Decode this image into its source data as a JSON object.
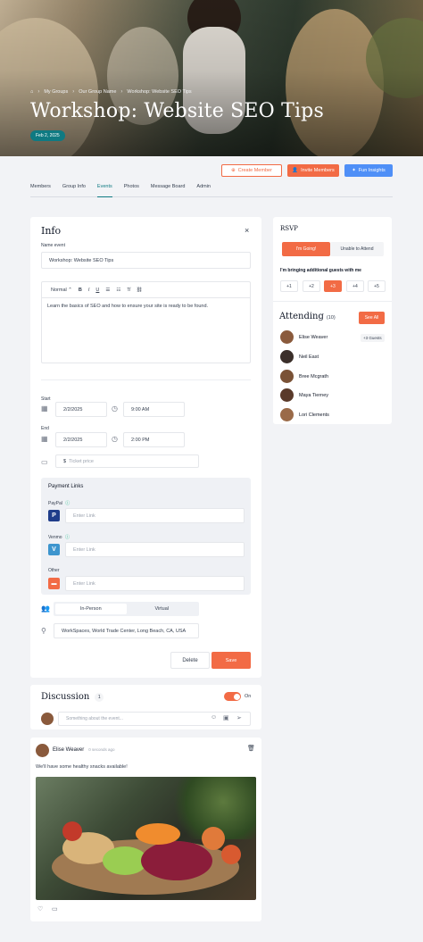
{
  "breadcrumb": [
    "My Groups",
    "Our Group Name",
    "Workshop: Website SEO Tips"
  ],
  "hero": {
    "title": "Workshop: Website SEO Tips",
    "date_badge": "Feb 2, 2025"
  },
  "actions": {
    "create_member": "Create Member",
    "invite_members": "Invite Members",
    "fun_insights": "Fun Insights"
  },
  "tabs": [
    {
      "label": "Members",
      "active": false
    },
    {
      "label": "Group Info",
      "active": false
    },
    {
      "label": "Events",
      "active": true
    },
    {
      "label": "Photos",
      "active": false
    },
    {
      "label": "Message Board",
      "active": false
    },
    {
      "label": "Admin",
      "active": false
    }
  ],
  "info": {
    "heading": "Info",
    "name_label": "Name event",
    "name_value": "Workshop: Website SEO Tips",
    "toolbar": {
      "style": "Normal",
      "bold": "B",
      "italic": "I",
      "underline": "U"
    },
    "description": "Learn the basics of SEO and how to ensure your site is ready to be found.",
    "start_label": "Start",
    "start_date": "2/2/2025",
    "start_time": "9:00 AM",
    "end_label": "End",
    "end_date": "2/2/2025",
    "end_time": "2:00 PM",
    "ticket_currency": "$",
    "ticket_placeholder": "Ticket price",
    "payment": {
      "heading": "Payment Links",
      "paypal_label": "PayPal",
      "venmo_label": "Venmo",
      "other_label": "Other",
      "link_placeholder": "Enter Link"
    },
    "mode_options": [
      "In-Person",
      "Virtual"
    ],
    "mode_selected": "In-Person",
    "location": "WorkSpaces, World Trade Center, Long Beach, CA, USA",
    "delete_label": "Delete",
    "save_label": "Save"
  },
  "rsvp": {
    "heading": "RSVP",
    "going": "I'm Going!",
    "unable": "Unable to Attend",
    "guests_label": "I'm bringing additional guests with me",
    "guest_options": [
      "+1",
      "+2",
      "+3",
      "+4",
      "+5"
    ],
    "guest_selected": "+3",
    "attending_heading": "Attending",
    "attending_count": "(10)",
    "see_all": "See All",
    "attendees": [
      {
        "name": "Elise Weaver",
        "badge": "+3 Guests",
        "color": "#8a5a3c"
      },
      {
        "name": "Neil East",
        "badge": "",
        "color": "#3b2f2a"
      },
      {
        "name": "Bree Mcgrath",
        "badge": "",
        "color": "#7a5236"
      },
      {
        "name": "Maya Tierney",
        "badge": "",
        "color": "#5a3a2a"
      },
      {
        "name": "Lori Clements",
        "badge": "",
        "color": "#9a6a48"
      }
    ]
  },
  "discussion": {
    "heading": "Discussion",
    "count": "1",
    "toggle_label": "On",
    "comment_placeholder": "Something about the event..."
  },
  "post": {
    "author": "Elise Weaver",
    "time": "0 seconds ago",
    "text": "We'll have some healthy snacks available!"
  },
  "colors": {
    "accent": "#f26b45",
    "teal": "#0f7a82",
    "blue": "#4f8ff7"
  }
}
